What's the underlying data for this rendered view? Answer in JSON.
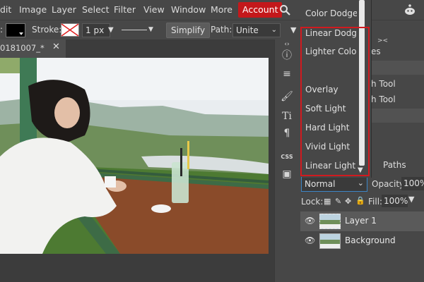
{
  "menubar": {
    "items": [
      "dit",
      "Image",
      "Layer",
      "Select",
      "Filter",
      "View",
      "Window",
      "More"
    ],
    "account": "Account"
  },
  "options": {
    "stroke_label": "Stroke:",
    "stroke_width": "1 px",
    "simplify": "Simplify",
    "path_label": "Path:",
    "path_value": "Unite"
  },
  "document": {
    "tab_title": "0181007_*"
  },
  "blend_dropdown": {
    "items": [
      "Color Dodge",
      "Linear Dodge",
      "Lighter Color",
      "Overlay",
      "Soft Light",
      "Hard Light",
      "Vivid Light",
      "Linear Light"
    ]
  },
  "panel": {
    "partial_tab": "es",
    "partial_item1": "h Tool",
    "partial_item2": "h Tool",
    "paths_tab": "Paths",
    "blend_mode": "Normal",
    "opacity_label": "Opacity:",
    "opacity_value": "100%",
    "lock_label": "Lock:",
    "fill_label": "Fill:",
    "fill_value": "100%",
    "layers": [
      "Layer 1",
      "Background"
    ]
  },
  "tools": {
    "css_label": "CSS"
  },
  "colors": {
    "account_bg": "#c4181b",
    "highlight_frame": "#d11a1f",
    "panel_bg": "#474747",
    "canvas_bg": "#3c3c3c"
  }
}
